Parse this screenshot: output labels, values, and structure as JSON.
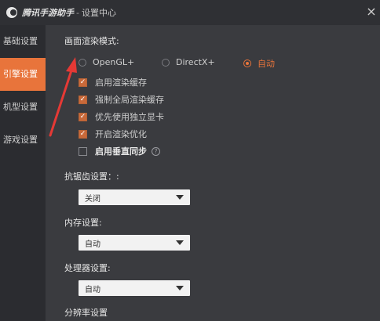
{
  "titlebar": {
    "app_name": "腾讯手游助手",
    "separator": "-",
    "window_title": "设置中心",
    "close_symbol": "×"
  },
  "sidebar": {
    "items": [
      {
        "label": "基础设置",
        "active": false
      },
      {
        "label": "引擎设置",
        "active": true
      },
      {
        "label": "机型设置",
        "active": false
      },
      {
        "label": "游戏设置",
        "active": false
      }
    ]
  },
  "render": {
    "title": "画面渲染模式:",
    "options": [
      {
        "label": "OpenGL+",
        "selected": false
      },
      {
        "label": "DirectX+",
        "selected": false
      },
      {
        "label": "自动",
        "selected": true
      }
    ],
    "checkboxes": [
      {
        "label": "启用渲染缓存",
        "checked": true
      },
      {
        "label": "强制全局渲染缓存",
        "checked": true
      },
      {
        "label": "优先使用独立显卡",
        "checked": true
      },
      {
        "label": "开启渲染优化",
        "checked": true
      },
      {
        "label": "启用垂直同步",
        "checked": false
      }
    ],
    "help_symbol": "?"
  },
  "antialias": {
    "title": "抗锯齿设置：:",
    "value": "关闭"
  },
  "memory": {
    "title": "内存设置:",
    "value": "自动"
  },
  "processor": {
    "title": "处理器设置:",
    "value": "自动"
  },
  "resolution": {
    "title": "分辨率设置"
  },
  "colors": {
    "accent": "#e8743b",
    "annotation_arrow": "#e53935"
  }
}
